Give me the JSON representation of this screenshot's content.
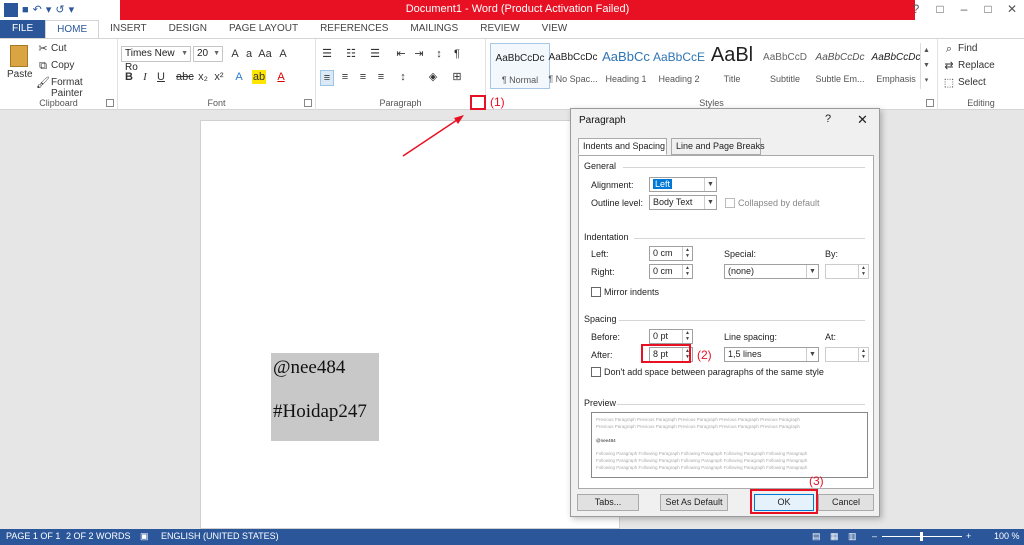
{
  "titlebar": {
    "title": "Document1 - Word (Product Activation Failed)",
    "help": "?",
    "restore": "□",
    "minimize": "–",
    "maximize": "□",
    "close": "✕"
  },
  "qat": {
    "logo": "W",
    "save": "■",
    "undo": "↶",
    "undo_dd": "▾",
    "redo": "↺",
    "customize": "▾"
  },
  "tabs": [
    "FILE",
    "HOME",
    "INSERT",
    "DESIGN",
    "PAGE LAYOUT",
    "REFERENCES",
    "MAILINGS",
    "REVIEW",
    "VIEW"
  ],
  "clipboard": {
    "paste": "Paste",
    "cut": "Cut",
    "copy": "Copy",
    "format_painter": "Format Painter",
    "label": "Clipboard"
  },
  "font": {
    "name": "Times New Ro",
    "size": "20",
    "label": "Font"
  },
  "paragraph": {
    "label": "Paragraph"
  },
  "styles": {
    "label": "Styles",
    "items": [
      {
        "sample": "AaBbCcDc",
        "name": "¶ Normal"
      },
      {
        "sample": "AaBbCcDc",
        "name": "¶ No Spac..."
      },
      {
        "sample": "AaBbCc",
        "name": "Heading 1"
      },
      {
        "sample": "AaBbCcE",
        "name": "Heading 2"
      },
      {
        "sample": "AaBl",
        "name": "Title"
      },
      {
        "sample": "AaBbCcD",
        "name": "Subtitle"
      },
      {
        "sample": "AaBbCcDc",
        "name": "Subtle Em..."
      },
      {
        "sample": "AaBbCcDc",
        "name": "Emphasis"
      }
    ]
  },
  "editing": {
    "find": "Find",
    "replace": "Replace",
    "select": "Select",
    "label": "Editing"
  },
  "document": {
    "line1": "@nee484",
    "line2": "#Hoidap247"
  },
  "dialog": {
    "title": "Paragraph",
    "help": "?",
    "close": "✕",
    "tabs": [
      "Indents and Spacing",
      "Line and Page Breaks"
    ],
    "general": {
      "section": "General",
      "alignment_label": "Alignment:",
      "alignment": "Left",
      "outline_label": "Outline level:",
      "outline": "Body Text",
      "collapsed": "Collapsed by default"
    },
    "indentation": {
      "section": "Indentation",
      "left_label": "Left:",
      "left": "0 cm",
      "right_label": "Right:",
      "right": "0 cm",
      "special_label": "Special:",
      "special": "(none)",
      "by_label": "By:",
      "mirror": "Mirror indents"
    },
    "spacing": {
      "section": "Spacing",
      "before_label": "Before:",
      "before": "0 pt",
      "after_label": "After:",
      "after": "8 pt",
      "line_label": "Line spacing:",
      "line": "1,5 lines",
      "at_label": "At:",
      "dont_add": "Don't add space between paragraphs of the same style"
    },
    "preview": {
      "section": "Preview",
      "prev_text": "Previous Paragraph Previous Paragraph Previous Paragraph Previous Paragraph Previous Paragraph",
      "sample": "@nee484",
      "follow_text": "Following Paragraph Following Paragraph Following Paragraph Following Paragraph Following Paragraph"
    },
    "buttons": {
      "tabs": "Tabs...",
      "default": "Set As Default",
      "ok": "OK",
      "cancel": "Cancel"
    }
  },
  "annotations": {
    "a1": "(1)",
    "a2": "(2)",
    "a3": "(3)"
  },
  "statusbar": {
    "page": "PAGE 1 OF 1",
    "words": "2 OF 2 WORDS",
    "language": "ENGLISH (UNITED STATES)",
    "zoom": "100 %",
    "minus": "–",
    "plus": "+"
  },
  "colors": {
    "accent": "#2b579a",
    "title_bar": "#e81123",
    "annotation": "#e81123",
    "selection": "#c8c8c8"
  }
}
